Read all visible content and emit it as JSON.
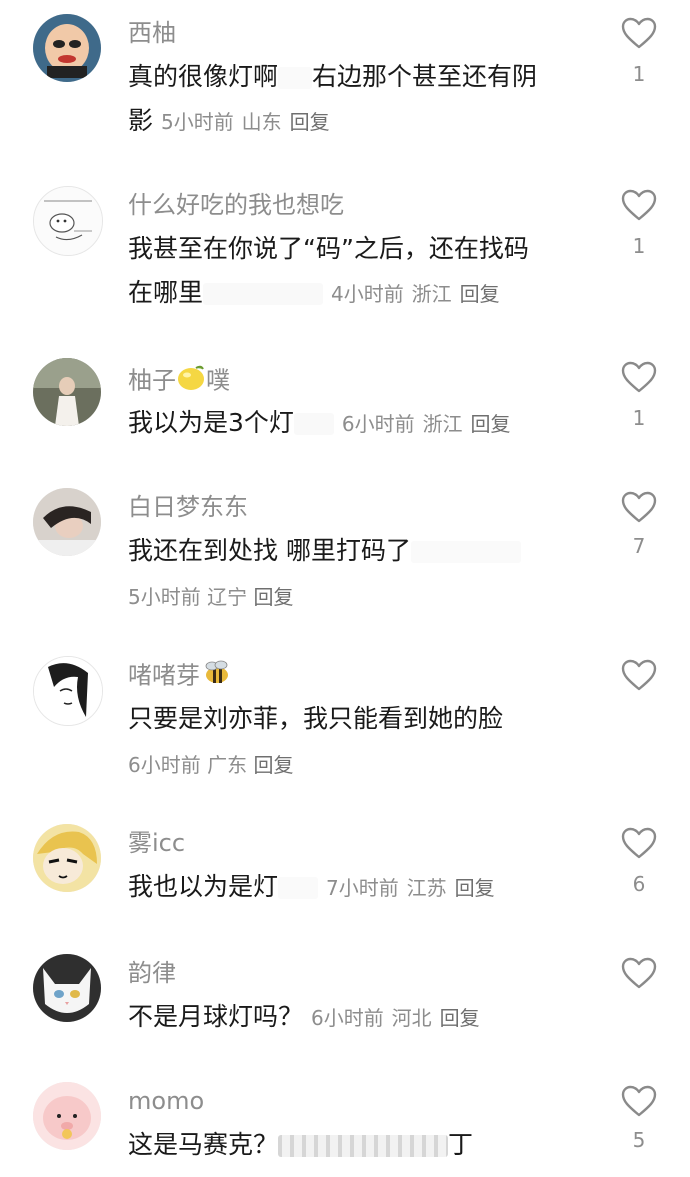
{
  "comments": [
    {
      "name": "西柚",
      "text1": "真的很像灯啊",
      "text2": "右边那个甚至还有阴",
      "text3": "影",
      "time": "5小时前",
      "location": "山东",
      "reply": "回复",
      "likes": "1"
    },
    {
      "name": "什么好吃的我也想吃",
      "text1": "我甚至在你说了“码”之后，还在找码",
      "text2": "在哪里",
      "time": "4小时前",
      "location": "浙江",
      "reply": "回复",
      "likes": "1"
    },
    {
      "name": "柚子",
      "name_suffix": "噗",
      "text1": "我以为是3个灯",
      "time": "6小时前",
      "location": "浙江",
      "reply": "回复",
      "likes": "1"
    },
    {
      "name": "白日梦东东",
      "text1": "我还在到处找 哪里打码了",
      "time": "5小时前",
      "location": "辽宁",
      "reply": "回复",
      "likes": "7"
    },
    {
      "name": "啫啫芽",
      "text1": "只要是刘亦菲，我只能看到她的脸",
      "time": "6小时前",
      "location": "广东",
      "reply": "回复",
      "likes": ""
    },
    {
      "name": "雾icc",
      "text1": "我也以为是灯",
      "time": "7小时前",
      "location": "江苏",
      "reply": "回复",
      "likes": "6"
    },
    {
      "name": "韵律",
      "text1": "不是月球灯吗？",
      "time": "6小时前",
      "location": "河北",
      "reply": "回复",
      "likes": ""
    },
    {
      "name": "momo",
      "text1": "这是马赛克？",
      "text_tail": "丁",
      "likes": "5"
    }
  ],
  "colors": {
    "name": "#8d8d8d",
    "text": "#1a1a1a",
    "meta": "#8d8d8d",
    "icon": "#8a8a8a"
  },
  "icons": {
    "like": "heart-outline-icon"
  }
}
